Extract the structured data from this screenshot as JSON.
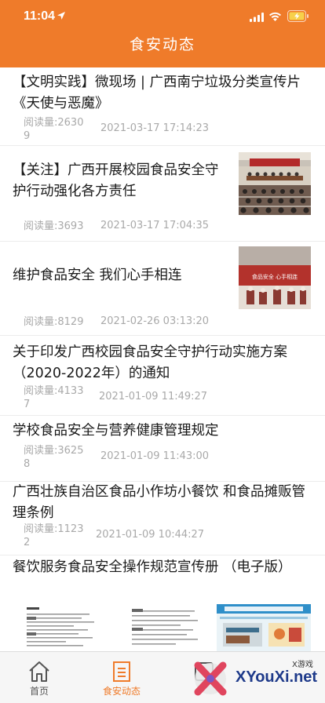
{
  "status_bar": {
    "time": "11:04"
  },
  "header": {
    "title": "食安动态"
  },
  "news": [
    {
      "title": "【文明实践】微现场 | 广西南宁垃圾分类宣传片《天使与恶魔》",
      "views": "阅读量:26309",
      "date": "2021-03-17 17:14:23"
    },
    {
      "title": "【关注】广西开展校园食品安全守护行动强化各方责任",
      "views": "阅读量:3693",
      "date": "2021-03-17 17:04:35"
    },
    {
      "title": "维护食品安全 我们心手相连",
      "views": "阅读量:8129",
      "date": "2021-02-26 03:13:20",
      "thumb_text": "食品安全 心手相连"
    },
    {
      "title": "关于印发广西校园食品安全守护行动实施方案（2020-2022年）的通知",
      "views": "阅读量:41337",
      "date": "2021-01-09 11:49:27"
    },
    {
      "title": "学校食品安全与营养健康管理规定",
      "views": "阅读量:36258",
      "date": "2021-01-09 11:43:00"
    },
    {
      "title": "广西壮族自治区食品小作坊小餐饮 和食品摊贩管理条例",
      "views": "阅读量:11232",
      "date": "2021-01-09 10:44:27"
    },
    {
      "title": "餐饮服务食品安全操作规范宣传册 （电子版）"
    }
  ],
  "tabbar": {
    "tabs": [
      {
        "label": "首页",
        "icon": "home-icon"
      },
      {
        "label": "食安动态",
        "icon": "news-icon"
      },
      {
        "label": "",
        "icon": "profile-icon"
      }
    ],
    "active_color": "#ef7b2a"
  },
  "watermark": {
    "text": "XYouXi.net",
    "sub": "X游戏"
  },
  "colors": {
    "header": "#ef7b2a",
    "meta_text": "#a9a9a9"
  }
}
